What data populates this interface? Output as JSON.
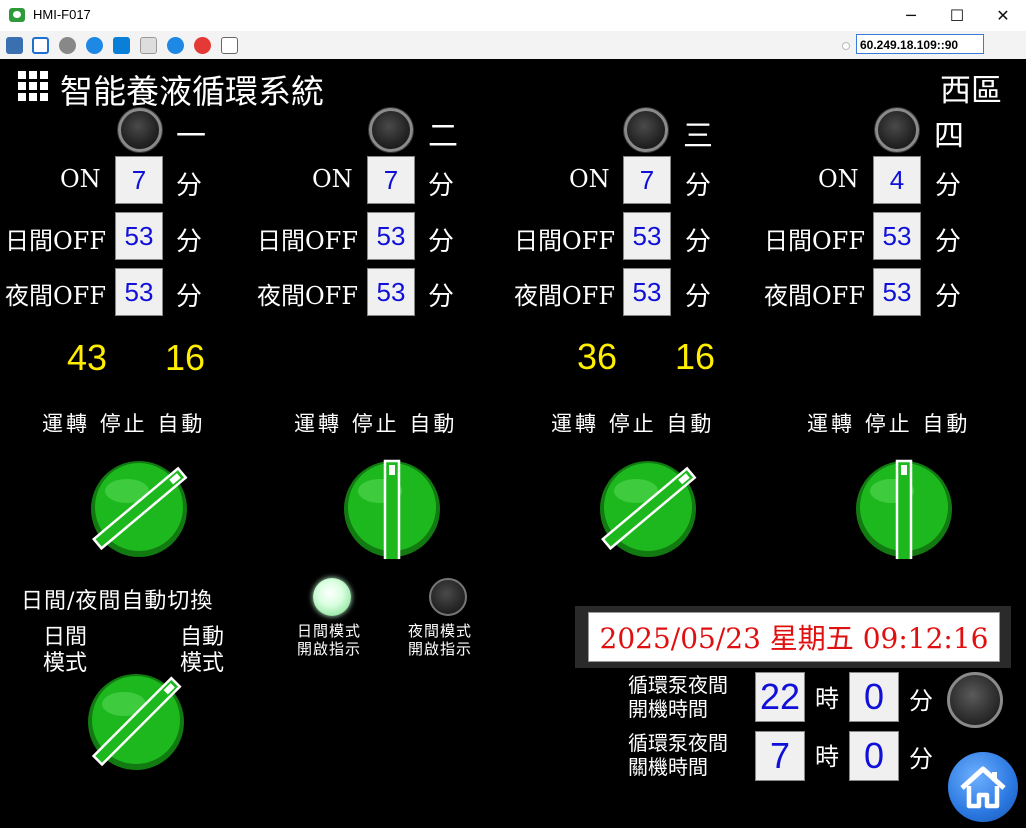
{
  "window": {
    "title": "HMI-F017",
    "address": "60.249.18.109::90",
    "min_glyph": "─",
    "max_glyph": "☐",
    "close_glyph": "✕"
  },
  "header": {
    "title": "智能養液循環系統",
    "region": "西區"
  },
  "columns": [
    {
      "label": "一",
      "on_label": "ON",
      "on": "7",
      "day_off_label": "日間OFF",
      "day_off": "53",
      "night_off_label": "夜間OFF",
      "night_off": "53",
      "unit": "分",
      "counter_a": "43",
      "counter_b": "16",
      "run": "運轉",
      "stop": "停止",
      "auto": "自動",
      "switch_position": "auto"
    },
    {
      "label": "二",
      "on_label": "ON",
      "on": "7",
      "day_off_label": "日間OFF",
      "day_off": "53",
      "night_off_label": "夜間OFF",
      "night_off": "53",
      "unit": "分",
      "counter_a": "",
      "counter_b": "",
      "run": "運轉",
      "stop": "停止",
      "auto": "自動",
      "switch_position": "stop"
    },
    {
      "label": "三",
      "on_label": "ON",
      "on": "7",
      "day_off_label": "日間OFF",
      "day_off": "53",
      "night_off_label": "夜間OFF",
      "night_off": "53",
      "unit": "分",
      "counter_a": "36",
      "counter_b": "16",
      "run": "運轉",
      "stop": "停止",
      "auto": "自動",
      "switch_position": "auto"
    },
    {
      "label": "四",
      "on_label": "ON",
      "on": "4",
      "day_off_label": "日間OFF",
      "day_off": "53",
      "night_off_label": "夜間OFF",
      "night_off": "53",
      "unit": "分",
      "counter_a": "",
      "counter_b": "",
      "run": "運轉",
      "stop": "停止",
      "auto": "自動",
      "switch_position": "stop"
    }
  ],
  "daynight": {
    "title": "日間/夜間自動切換",
    "day_mode_1": "日間",
    "day_mode_2": "模式",
    "auto_mode_1": "自動",
    "auto_mode_2": "模式",
    "switch_position": "auto"
  },
  "indicators": {
    "day_1": "日間模式",
    "day_2": "開啟指示",
    "day_state": "on",
    "night_1": "夜間模式",
    "night_2": "開啟指示",
    "night_state": "off"
  },
  "datetime": "2025/05/23 星期五 09:12:16",
  "pump": {
    "on_label_1": "循環泵夜間",
    "on_label_2": "開機時間",
    "on_hour": "22",
    "on_min": "0",
    "off_label_1": "循環泵夜間",
    "off_label_2": "關機時間",
    "off_hour": "7",
    "off_min": "0",
    "hour_unit": "時",
    "min_unit": "分",
    "status": "off"
  },
  "colors": {
    "knob_green": "#1db81d",
    "yellow": "#ffee00",
    "value_blue": "#1010d8",
    "date_red": "#e01010"
  }
}
